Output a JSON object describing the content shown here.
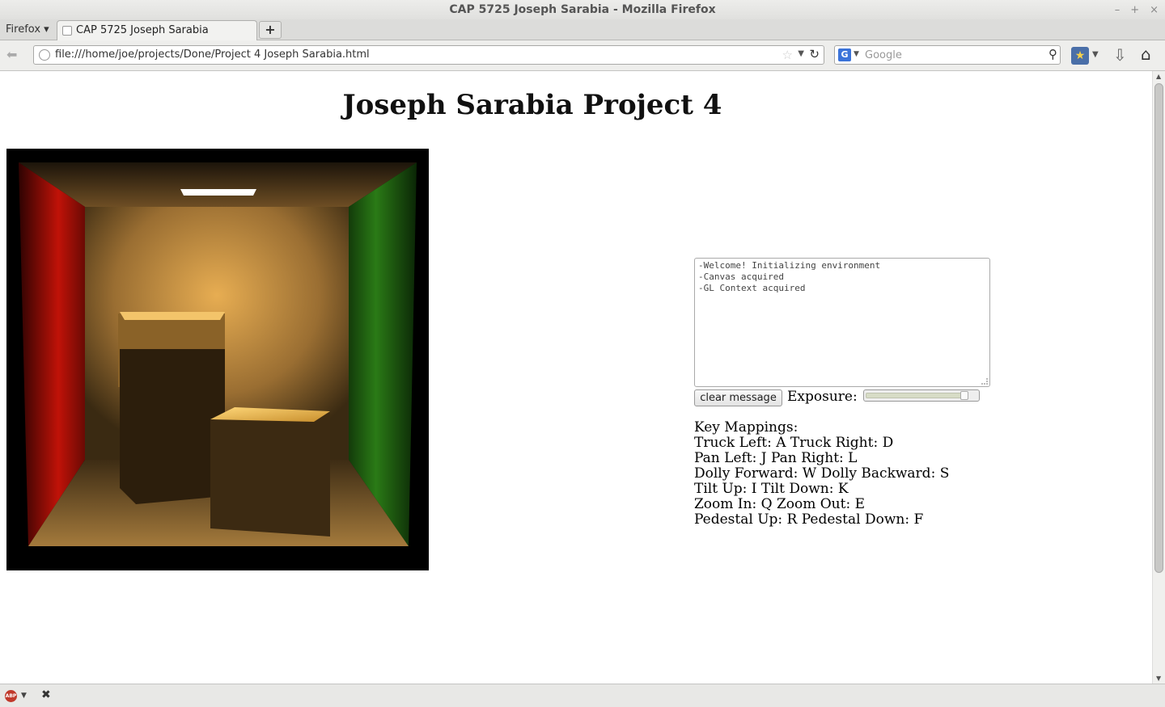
{
  "window": {
    "title": "CAP 5725 Joseph Sarabia - Mozilla Firefox",
    "controls": {
      "minimize": "–",
      "maximize": "+",
      "close": "×"
    }
  },
  "menu": {
    "firefox_label": "Firefox ▾"
  },
  "tabs": [
    {
      "label": "CAP 5725 Joseph Sarabia",
      "active": true
    }
  ],
  "new_tab_label": "+",
  "address_bar": {
    "url": "file:///home/joe/projects/Done/Project 4 Joseph Sarabia.html"
  },
  "search_bar": {
    "engine_icon": "G",
    "placeholder": "Google"
  },
  "page": {
    "title": "Joseph Sarabia Project 4",
    "message_log": [
      "-Welcome! Initializing environment",
      "-Canvas acquired",
      "-GL Context acquired"
    ],
    "clear_button_label": "clear message",
    "exposure_label": "Exposure:",
    "exposure_level": 0.93,
    "key_mappings_heading": "Key Mappings:",
    "key_mappings": [
      "Truck Left: A Truck Right: D",
      "Pan Left: J Pan Right: L",
      "Dolly Forward: W Dolly Backward: S",
      "Tilt Up: I Tilt Down: K",
      "Zoom In: Q Zoom Out: E",
      "Pedestal Up: R Pedestal Down: F"
    ]
  },
  "status_bar": {
    "abp_label": "ABP"
  },
  "colors": {
    "left_wall": "#b3100a",
    "right_wall": "#1f6b12",
    "back_wall": "#c99442",
    "light": "#ffffff"
  }
}
